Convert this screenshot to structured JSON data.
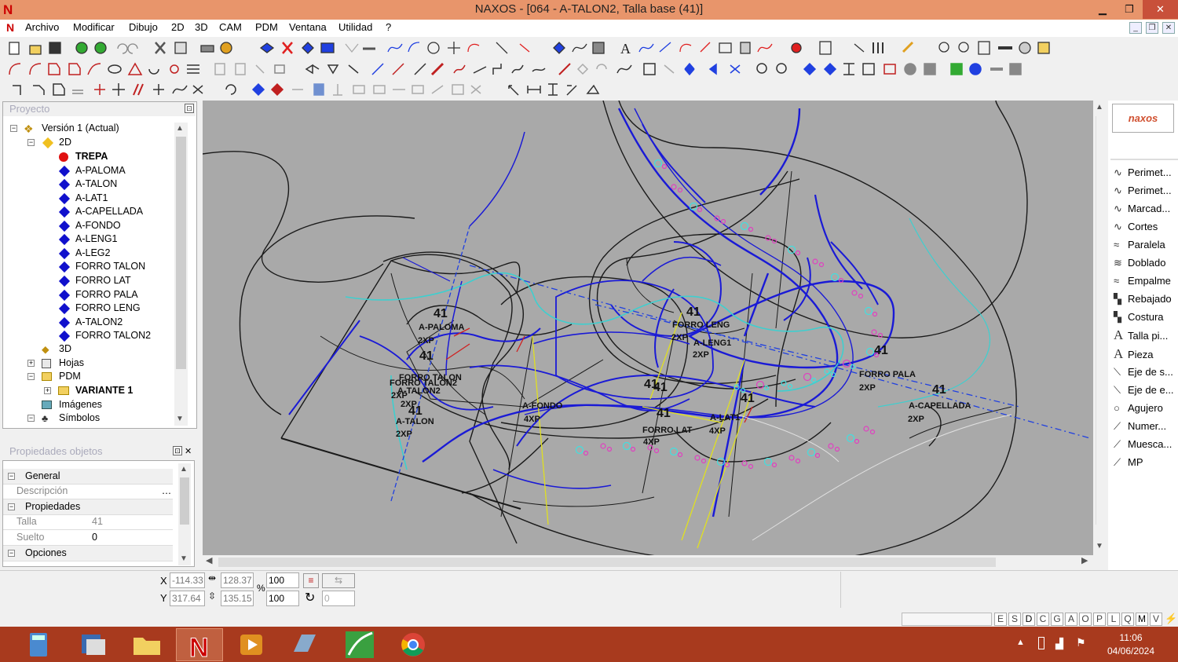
{
  "window": {
    "title": "NAXOS - [064 - A-TALON2, Talla base (41)]",
    "logo_letter": "N",
    "minimize": "▁",
    "maximize": "❐",
    "close": "✕"
  },
  "menu": [
    "Archivo",
    "Modificar",
    "Dibujo",
    "2D",
    "3D",
    "CAM",
    "PDM",
    "Ventana",
    "Utilidad",
    "?"
  ],
  "project": {
    "header": "Proyecto",
    "version": "Versión 1 (Actual)",
    "node_2d": "2D",
    "pieces": [
      "TREPA",
      "A-PALOMA",
      "A-TALON",
      "A-LAT1",
      "A-CAPELLADA",
      "A-FONDO",
      "A-LENG1",
      "A-LEG2",
      "FORRO TALON",
      "FORRO LAT",
      "FORRO PALA",
      "FORRO LENG",
      "A-TALON2",
      "FORRO TALON2"
    ],
    "node_3d": "3D",
    "hojas": "Hojas",
    "pdm": "PDM",
    "variante": "VARIANTE 1",
    "imagenes": "Imágenes",
    "simbolos": "Símbolos"
  },
  "properties": {
    "header": "Propiedades objetos",
    "general": "General",
    "descripcion_label": "Descripción",
    "descripcion_value": "",
    "propiedades": "Propiedades",
    "talla_label": "Talla",
    "talla_value": "41",
    "suelto_label": "Suelto",
    "suelto_value": "0",
    "opciones": "Opciones"
  },
  "canvas": {
    "labels": [
      {
        "text": "41",
        "kind": "size"
      },
      {
        "text": "A-PALOMA",
        "kind": "name"
      },
      {
        "text": "2XP",
        "kind": "count"
      },
      {
        "text": "41",
        "kind": "size"
      },
      {
        "text": "FORRO TALON",
        "kind": "name"
      },
      {
        "text": "FORRO TALON2",
        "kind": "name"
      },
      {
        "text": "2XP",
        "kind": "count"
      },
      {
        "text": "A-TALON2",
        "kind": "name"
      },
      {
        "text": "2XP",
        "kind": "count"
      },
      {
        "text": "41",
        "kind": "size"
      },
      {
        "text": "A-TALON",
        "kind": "name"
      },
      {
        "text": "2XP",
        "kind": "count"
      },
      {
        "text": "A-FONDO",
        "kind": "name"
      },
      {
        "text": "4XP",
        "kind": "count"
      },
      {
        "text": "41",
        "kind": "size"
      },
      {
        "text": "FORRO LAT",
        "kind": "name"
      },
      {
        "text": "4XP",
        "kind": "count"
      },
      {
        "text": "41",
        "kind": "size"
      },
      {
        "text": "41",
        "kind": "size"
      },
      {
        "text": "FORRO LENG",
        "kind": "name"
      },
      {
        "text": "2XP",
        "kind": "count"
      },
      {
        "text": "A-LENG1",
        "kind": "name"
      },
      {
        "text": "2XP",
        "kind": "count"
      },
      {
        "text": "41",
        "kind": "size"
      },
      {
        "text": "41",
        "kind": "size"
      },
      {
        "text": "A-LAT1",
        "kind": "name"
      },
      {
        "text": "4XP",
        "kind": "count"
      },
      {
        "text": "41",
        "kind": "size"
      },
      {
        "text": "FORRO PALA",
        "kind": "name"
      },
      {
        "text": "2XP",
        "kind": "count"
      },
      {
        "text": "41",
        "kind": "size"
      },
      {
        "text": "A-CAPELLADA",
        "kind": "name"
      },
      {
        "text": "2XP",
        "kind": "count"
      }
    ],
    "colors": {
      "background": "#a9a9a9",
      "outline": "#1a1a1a",
      "piece_blue": "#1a1ad6",
      "accent_cyan": "#3ecfcf",
      "marker_pink": "#e040c0",
      "marker_cyan": "#40e0e0",
      "dash_blue": "#2040e0",
      "guide_yellow": "#e0e020",
      "cut_red": "#d02020"
    }
  },
  "right_panel": {
    "logo": "naxos",
    "items": [
      {
        "label": "Perimet...",
        "icon": "curve-icon"
      },
      {
        "label": "Perimet...",
        "icon": "curve-icon"
      },
      {
        "label": "Marcad...",
        "icon": "curve-icon"
      },
      {
        "label": "Cortes",
        "icon": "curve-icon"
      },
      {
        "label": "Paralela",
        "icon": "parallel-icon"
      },
      {
        "label": "Doblado",
        "icon": "fold-icon"
      },
      {
        "label": "Empalme",
        "icon": "join-icon"
      },
      {
        "label": "Rebajado",
        "icon": "skive-icon"
      },
      {
        "label": "Costura",
        "icon": "stitch-icon"
      },
      {
        "label": "Talla pi...",
        "icon": "text-icon"
      },
      {
        "label": "Pieza",
        "icon": "text-icon"
      },
      {
        "label": "Eje de s...",
        "icon": "axis-icon"
      },
      {
        "label": "Eje de e...",
        "icon": "axis-icon"
      },
      {
        "label": "Agujero",
        "icon": "hole-icon"
      },
      {
        "label": "Numer...",
        "icon": "number-icon"
      },
      {
        "label": "Muesca...",
        "icon": "notch-icon"
      },
      {
        "label": "MP",
        "icon": "mp-icon"
      }
    ]
  },
  "status": {
    "x_label": "X",
    "y_label": "Y",
    "x_value": "-114.33",
    "y_value": "317.64",
    "w_value": "128.37",
    "h_value": "135.15",
    "pct_symbol": "%",
    "scale_x": "100",
    "scale_y": "100",
    "rotation": "0"
  },
  "indicators": [
    "E",
    "S",
    "D",
    "C",
    "G",
    "A",
    "O",
    "P",
    "L",
    "Q",
    "M",
    "V"
  ],
  "taskbar": {
    "time": "11:06",
    "date": "04/06/2024"
  }
}
